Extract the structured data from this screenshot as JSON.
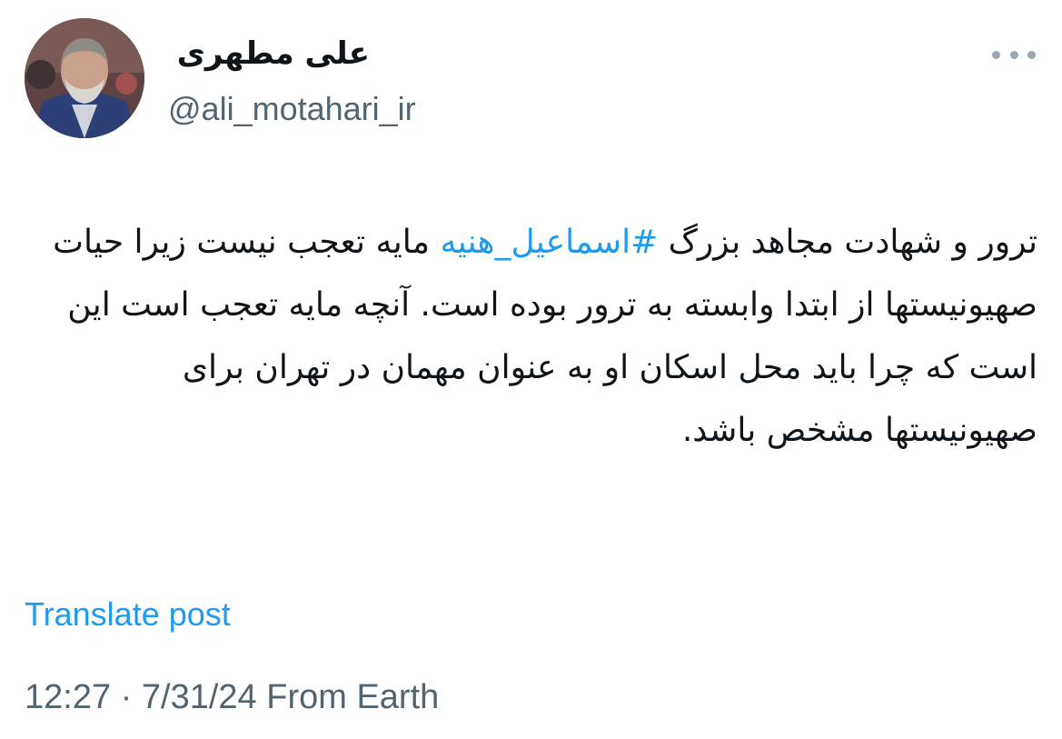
{
  "author": {
    "display_name": "علی مطهری",
    "handle": "@ali_motahari_ir"
  },
  "post": {
    "text_before": "ترور و شهادت مجاهد بزرگ ",
    "hashtag": "#اسماعیل_هنیه",
    "text_after": " مایه تعجب نیست زیرا حیات صهیونیستها از ابتدا وابسته به ترور بوده است. آنچه مایه تعجب است این است که چرا باید محل اسکان او به عنوان مهمان در تهران برای صهیونیستها مشخص باشد."
  },
  "translate_label": "Translate post",
  "meta": {
    "time": "12:27",
    "separator": " · ",
    "date": "7/31/24",
    "source": " From Earth"
  },
  "icons": {
    "more": "more-horizontal-icon",
    "avatar": "profile-avatar"
  },
  "colors": {
    "text": "#0f1419",
    "secondary": "#536471",
    "accent": "#1d9bf0"
  }
}
